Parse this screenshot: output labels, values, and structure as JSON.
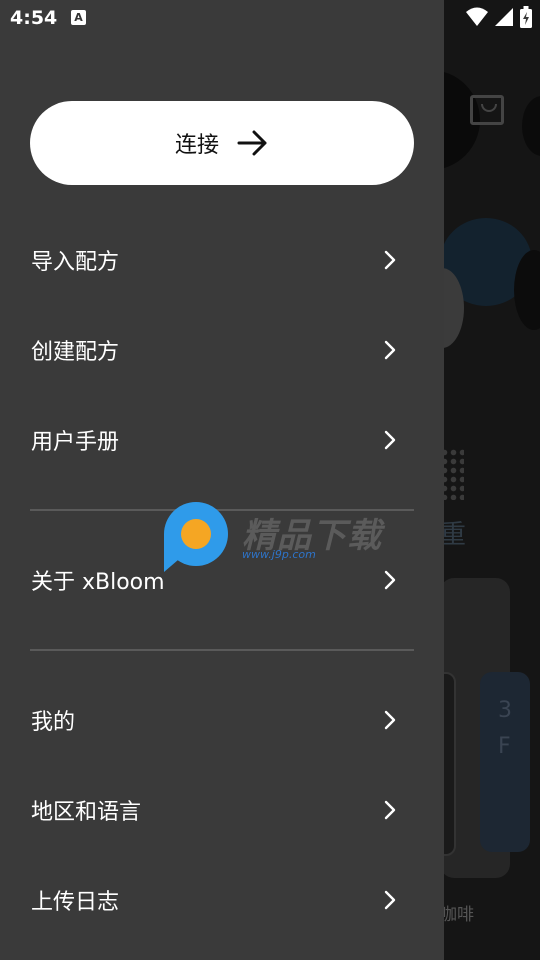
{
  "status_bar": {
    "time": "4:54",
    "notification_icon_letter": "A",
    "icons": [
      "wifi-icon",
      "signal-icon",
      "battery-charging-icon"
    ]
  },
  "drawer": {
    "connect_button": {
      "label": "连接",
      "icon": "arrow-right-icon"
    },
    "menu_items": [
      {
        "label": "导入配方",
        "icon": "chevron-right-icon"
      },
      {
        "label": "创建配方",
        "icon": "chevron-right-icon"
      },
      {
        "label": "用户手册",
        "icon": "chevron-right-icon"
      },
      {
        "label": "关于 xBloom",
        "icon": "chevron-right-icon"
      },
      {
        "label": "我的",
        "icon": "chevron-right-icon"
      },
      {
        "label": "地区和语言",
        "icon": "chevron-right-icon"
      },
      {
        "label": "上传日志",
        "icon": "chevron-right-icon"
      }
    ]
  },
  "background": {
    "weight_label": "重",
    "card_text_1": "3",
    "card_text_2": "F",
    "coffee_label": "咖啡"
  },
  "watermark": {
    "title": "精品下载",
    "url": "www.j9p.com"
  },
  "colors": {
    "drawer_bg": "#3a3a3a",
    "button_bg": "#ffffff",
    "watermark_blue": "#2f9bea",
    "watermark_orange": "#f5a623"
  }
}
